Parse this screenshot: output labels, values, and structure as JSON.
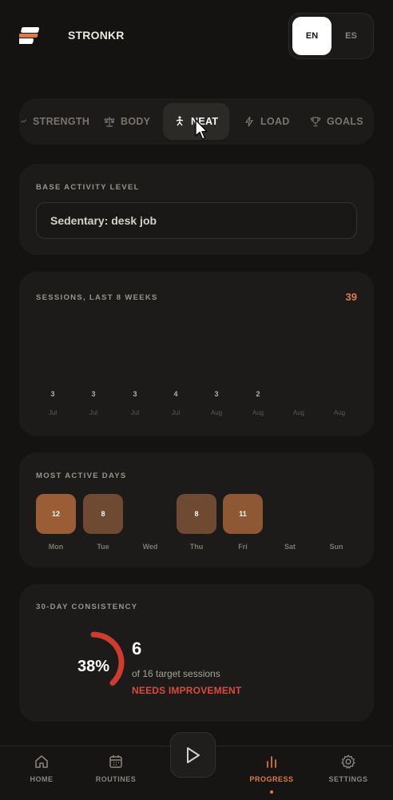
{
  "app": {
    "title": "STRONKR"
  },
  "language": {
    "options": [
      "EN",
      "ES"
    ],
    "selected": "EN"
  },
  "tabs": [
    {
      "label": "STRENGTH",
      "icon": "trend-icon"
    },
    {
      "label": "BODY",
      "icon": "scale-icon"
    },
    {
      "label": "NEAT",
      "icon": "walking-person-icon",
      "active": true
    },
    {
      "label": "LOAD",
      "icon": "bolt-icon"
    },
    {
      "label": "GOALS",
      "icon": "trophy-icon"
    }
  ],
  "activity": {
    "label": "BASE ACTIVITY LEVEL",
    "selected": "Sedentary: desk job"
  },
  "sessions": {
    "label": "SESSIONS, LAST 8 WEEKS",
    "total": "39",
    "weeks": [
      {
        "value": "3",
        "month": "Jul"
      },
      {
        "value": "3",
        "month": "Jul"
      },
      {
        "value": "3",
        "month": "Jul"
      },
      {
        "value": "4",
        "month": "Jul"
      },
      {
        "value": "3",
        "month": "Aug"
      },
      {
        "value": "2",
        "month": "Aug"
      },
      {
        "value": "",
        "month": "Aug"
      },
      {
        "value": "",
        "month": "Aug"
      }
    ]
  },
  "days": {
    "label": "MOST ACTIVE DAYS",
    "items": [
      {
        "day": "Mon",
        "count": "12",
        "color": "#9a5d36"
      },
      {
        "day": "Tue",
        "count": "8",
        "color": "#6f4a33"
      },
      {
        "day": "Wed",
        "count": "",
        "color": ""
      },
      {
        "day": "Thu",
        "count": "8",
        "color": "#6f4a33"
      },
      {
        "day": "Fri",
        "count": "11",
        "color": "#8e5835"
      },
      {
        "day": "Sat",
        "count": "",
        "color": ""
      },
      {
        "day": "Sun",
        "count": "",
        "color": ""
      }
    ]
  },
  "consistency": {
    "label": "30-DAY CONSISTENCY",
    "percent_text": "38%",
    "percent": 38,
    "count": "6",
    "subtitle": "of 16 target sessions",
    "status": "NEEDS IMPROVEMENT",
    "ring_color": "#cf3b2f"
  },
  "nav": {
    "items": [
      {
        "label": "HOME",
        "icon": "home-icon"
      },
      {
        "label": "ROUTINES",
        "icon": "calendar-icon"
      },
      {
        "label": "PROGRESS",
        "icon": "bar-chart-icon",
        "active": true
      },
      {
        "label": "SETTINGS",
        "icon": "gear-icon"
      }
    ],
    "play_icon": "play-icon"
  },
  "colors": {
    "accent": "#e07b40",
    "background": "#141312",
    "card": "#1c1b19"
  }
}
